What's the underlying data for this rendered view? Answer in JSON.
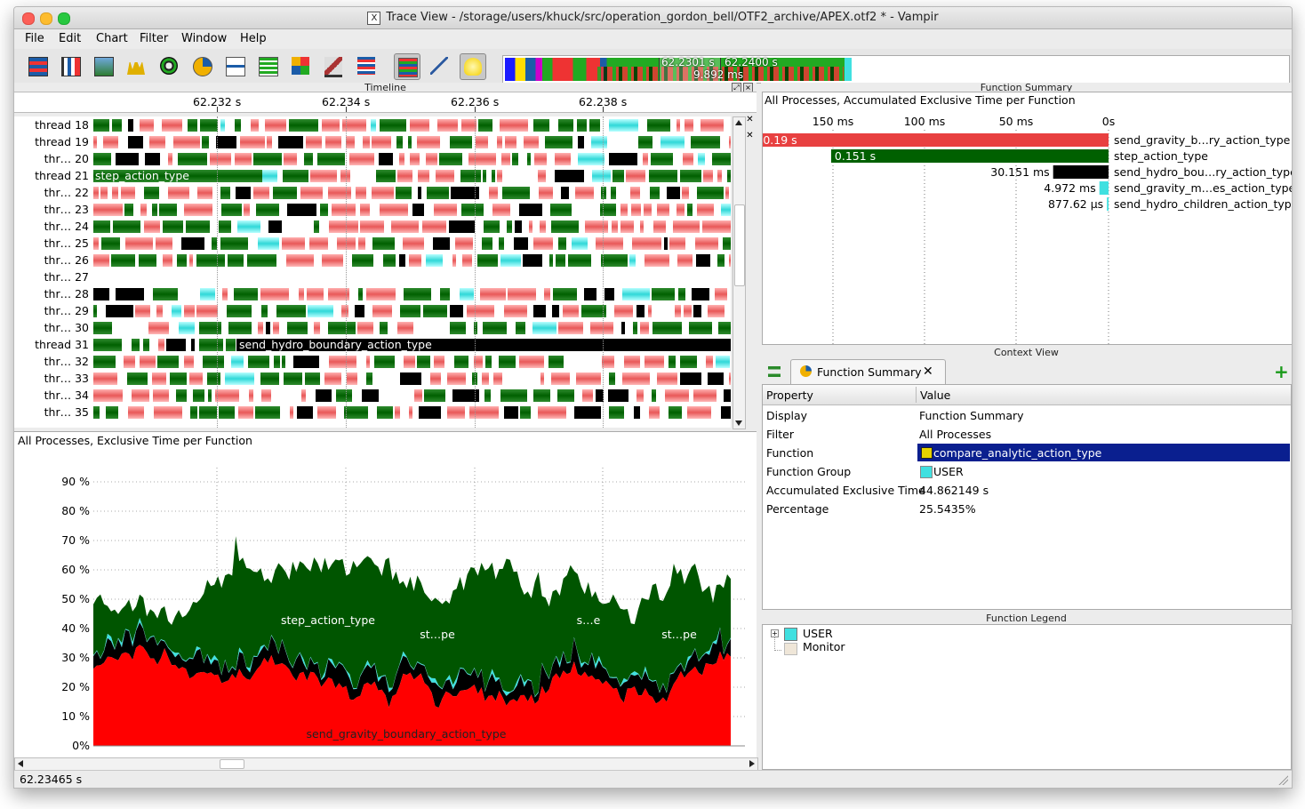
{
  "window": {
    "title": "Trace View - /storage/users/khuck/src/operation_gordon_bell/OTF2_archive/APEX.otf2 * - Vampir",
    "title_icon": "X"
  },
  "menu": [
    "File",
    "Edit",
    "Chart",
    "Filter",
    "Window",
    "Help"
  ],
  "toolbar": {
    "icons": [
      "master-timeline-icon",
      "process-timeline-icon",
      "counter-timeline-icon",
      "performance-radar-icon",
      "function-summary-icon",
      "process-summary-icon",
      "message-summary-icon",
      "communication-matrix-icon",
      "io-summary-icon",
      "call-tree-icon",
      "function-legend-icon",
      "filter-icon",
      "pin-icon",
      "lightbulb-icon"
    ],
    "overview_time_start": "62.2301 s",
    "overview_time_end": "62.2400 s",
    "overview_duration": "9.892 ms"
  },
  "timeline": {
    "panel_title": "Timeline",
    "ticks": [
      "62.232 s",
      "62.234 s",
      "62.236 s",
      "62.238 s"
    ],
    "threads": [
      "thread 18",
      "thread 19",
      "thr… 20",
      "thread 21",
      "thr… 22",
      "thr… 23",
      "thr… 24",
      "thr… 25",
      "thr… 26",
      "thr… 27",
      "thr… 28",
      "thr… 29",
      "thr… 30",
      "thread 31",
      "thr… 32",
      "thr… 33",
      "thr… 34",
      "thr… 35"
    ],
    "label_step": "step_action_type",
    "label_send_hydro": "send_hydro_boundary_action_type"
  },
  "chart": {
    "title": "All Processes, Exclusive Time per Function",
    "y_ticks": [
      "90 %",
      "80 %",
      "70 %",
      "60 %",
      "50 %",
      "40 %",
      "30 %",
      "20 %",
      "10 %",
      "0%"
    ],
    "labels": {
      "step": "step_action_type",
      "step_short_1": "st…pe",
      "step_short_2": "s…e",
      "step_short_3": "st…pe",
      "send_gravity": "send_gravity_boundary_action_type"
    },
    "colors": {
      "send_gravity": "#ff0000",
      "step": "#005500",
      "send_hydro": "#000000",
      "send_gravity_multipoles": "#40e0e0"
    }
  },
  "chart_data": {
    "type": "area",
    "title": "All Processes, Exclusive Time per Function",
    "xlabel": "",
    "ylabel": "",
    "ylim": [
      0,
      100
    ],
    "x": [
      "62.232 s",
      "62.234 s",
      "62.236 s",
      "62.238 s"
    ],
    "series": [
      {
        "name": "send_gravity_boundary_action_type",
        "values": [
          27,
          24,
          28,
          25
        ]
      },
      {
        "name": "step_action_type",
        "values": [
          50,
          52,
          51,
          53
        ]
      }
    ]
  },
  "function_summary": {
    "panel_title": "Function Summary",
    "subtitle": "All Processes, Accumulated Exclusive Time per Function",
    "axis_ticks": [
      "150 ms",
      "100 ms",
      "50 ms",
      "0s"
    ],
    "rows": [
      {
        "value": "0.19 s",
        "name": "send_gravity_b…ry_action_type",
        "color": "#e84040",
        "seconds": 0.19
      },
      {
        "value": "0.151 s",
        "name": "step_action_type",
        "color": "#006000",
        "seconds": 0.151
      },
      {
        "value": "30.151 ms",
        "name": "send_hydro_bou…ry_action_type",
        "color": "#000000",
        "seconds": 0.030151
      },
      {
        "value": "4.972 ms",
        "name": "send_gravity_m…es_action_type",
        "color": "#40e0e0",
        "seconds": 0.004972
      },
      {
        "value": "877.62 µs",
        "name": "send_hydro_children_action_type",
        "color": "#40e0e0",
        "seconds": 0.00087762
      }
    ]
  },
  "context_view": {
    "panel_title": "Context View",
    "tab_label": "Function Summary",
    "header_property": "Property",
    "header_value": "Value",
    "rows": [
      {
        "property": "Display",
        "value": "Function Summary"
      },
      {
        "property": "Filter",
        "value": "All Processes"
      },
      {
        "property": "Function",
        "value": "compare_analytic_action_type"
      },
      {
        "property": "Function Group",
        "value": "USER"
      },
      {
        "property": "Accumulated Exclusive Time",
        "value": "44.862149 s"
      },
      {
        "property": "Percentage",
        "value": "25.5435%"
      }
    ]
  },
  "function_legend": {
    "panel_title": "Function Legend",
    "items": [
      {
        "label": "USER",
        "color": "#40e0e0"
      },
      {
        "label": "Monitor",
        "color": "#efe6d8"
      }
    ]
  },
  "status": {
    "time": "62.23465 s"
  }
}
